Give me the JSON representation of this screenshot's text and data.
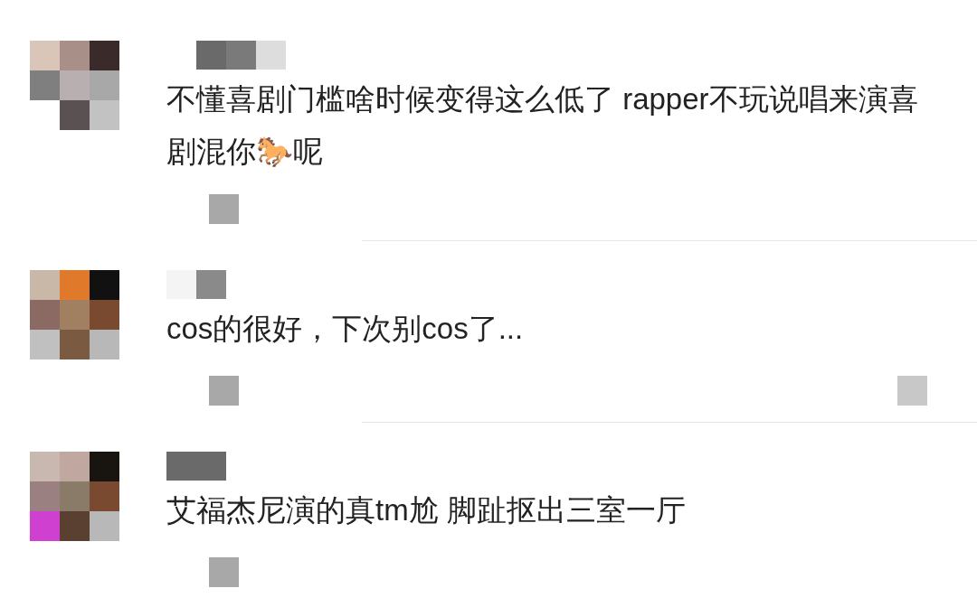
{
  "comments": [
    {
      "text": "不懂喜剧门槛啥时候变得这么低了  rapper不玩说唱来演喜剧混你🐎呢"
    },
    {
      "text": "cos的很好，下次别cos了..."
    },
    {
      "text": "艾福杰尼演的真tm尬 脚趾抠出三室一厅"
    }
  ]
}
